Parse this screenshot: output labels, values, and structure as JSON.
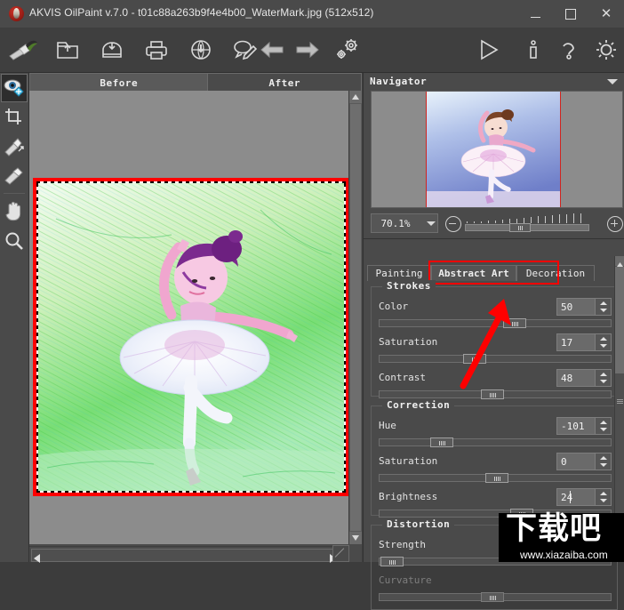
{
  "window": {
    "title": "AKVIS OilPaint v.7.0 - t01c88a263b9f4e4b00_WaterMark.jpg (512x512)",
    "app_icon": "akvis-oilpaint-logo",
    "minimize_label": "–",
    "maximize_label": "□",
    "close_label": "✕"
  },
  "toolbar": {
    "items": [
      {
        "name": "brush-logo-icon",
        "label": "AKVIS OilPaint"
      },
      {
        "name": "open-image-icon",
        "label": "Open Image"
      },
      {
        "name": "save-image-icon",
        "label": "Save Image"
      },
      {
        "name": "print-image-icon",
        "label": "Print Image"
      },
      {
        "name": "publish-web-icon",
        "label": "Publish Image"
      },
      {
        "name": "edit-comment-icon",
        "label": "Comment"
      },
      {
        "name": "undo-arrow-icon",
        "label": "Undo"
      },
      {
        "name": "redo-arrow-icon",
        "label": "Redo"
      },
      {
        "name": "presets-gears-icon",
        "label": "Presets"
      },
      {
        "name": "run-play-icon",
        "label": "Run"
      },
      {
        "name": "about-info-icon",
        "label": "About"
      },
      {
        "name": "help-question-icon",
        "label": "Help"
      },
      {
        "name": "preferences-gear-icon",
        "label": "Preferences"
      }
    ]
  },
  "tools": [
    {
      "name": "quick-preview-tool",
      "label": "Quick Preview",
      "selected": true
    },
    {
      "name": "crop-tool",
      "label": "Crop",
      "selected": false
    },
    {
      "name": "smudge-tool",
      "label": "Smudge",
      "selected": false
    },
    {
      "name": "eraser-tool",
      "label": "History Brush",
      "selected": false
    },
    {
      "name": "hand-tool",
      "label": "Hand",
      "selected": false
    },
    {
      "name": "zoom-tool",
      "label": "Zoom",
      "selected": false
    }
  ],
  "editor": {
    "tabs": [
      {
        "label": "Before",
        "active": true
      },
      {
        "label": "After",
        "active": false
      }
    ],
    "image_alt": "ballerina-sketch-green"
  },
  "navigator": {
    "title": "Navigator",
    "collapse_icon": "chevron-down-icon",
    "zoom_value": "70.1%",
    "zoom_out_icon": "minus-circle-icon",
    "zoom_in_icon": "plus-circle-icon",
    "thumbnail_alt": "ballerina-blue-thumbnail"
  },
  "settings": {
    "tabs": [
      {
        "label": "Painting",
        "active": false
      },
      {
        "label": "Abstract Art",
        "active": true
      },
      {
        "label": "Decoration",
        "active": false
      }
    ],
    "groups": [
      {
        "title": "Strokes",
        "params": [
          {
            "label": "Color",
            "value": "50",
            "slider_pct": 58,
            "disabled": false
          },
          {
            "label": "Saturation",
            "value": "17",
            "slider_pct": 40,
            "disabled": false
          },
          {
            "label": "Contrast",
            "value": "48",
            "slider_pct": 48,
            "disabled": false
          }
        ]
      },
      {
        "title": "Correction",
        "params": [
          {
            "label": "Hue",
            "value": "-101",
            "slider_pct": 25,
            "disabled": false
          },
          {
            "label": "Saturation",
            "value": "0",
            "slider_pct": 50,
            "disabled": false
          },
          {
            "label": "Brightness",
            "value": "24",
            "slider_pct": 60,
            "disabled": false,
            "focused": true
          }
        ]
      },
      {
        "title": "Distortion",
        "params": [
          {
            "label": "Strength",
            "value": "0",
            "slider_pct": 6,
            "disabled": false
          },
          {
            "label": "Curvature",
            "value": "",
            "slider_pct": 48,
            "disabled": true
          }
        ]
      }
    ]
  },
  "watermark": {
    "logo_text": "下载吧",
    "url": "www.xiazaiba.com"
  },
  "colors": {
    "accent_red": "#ff0000",
    "panel_bg": "#4a4a4a",
    "canvas_bg": "#8c8c8c",
    "text": "#ededed"
  }
}
